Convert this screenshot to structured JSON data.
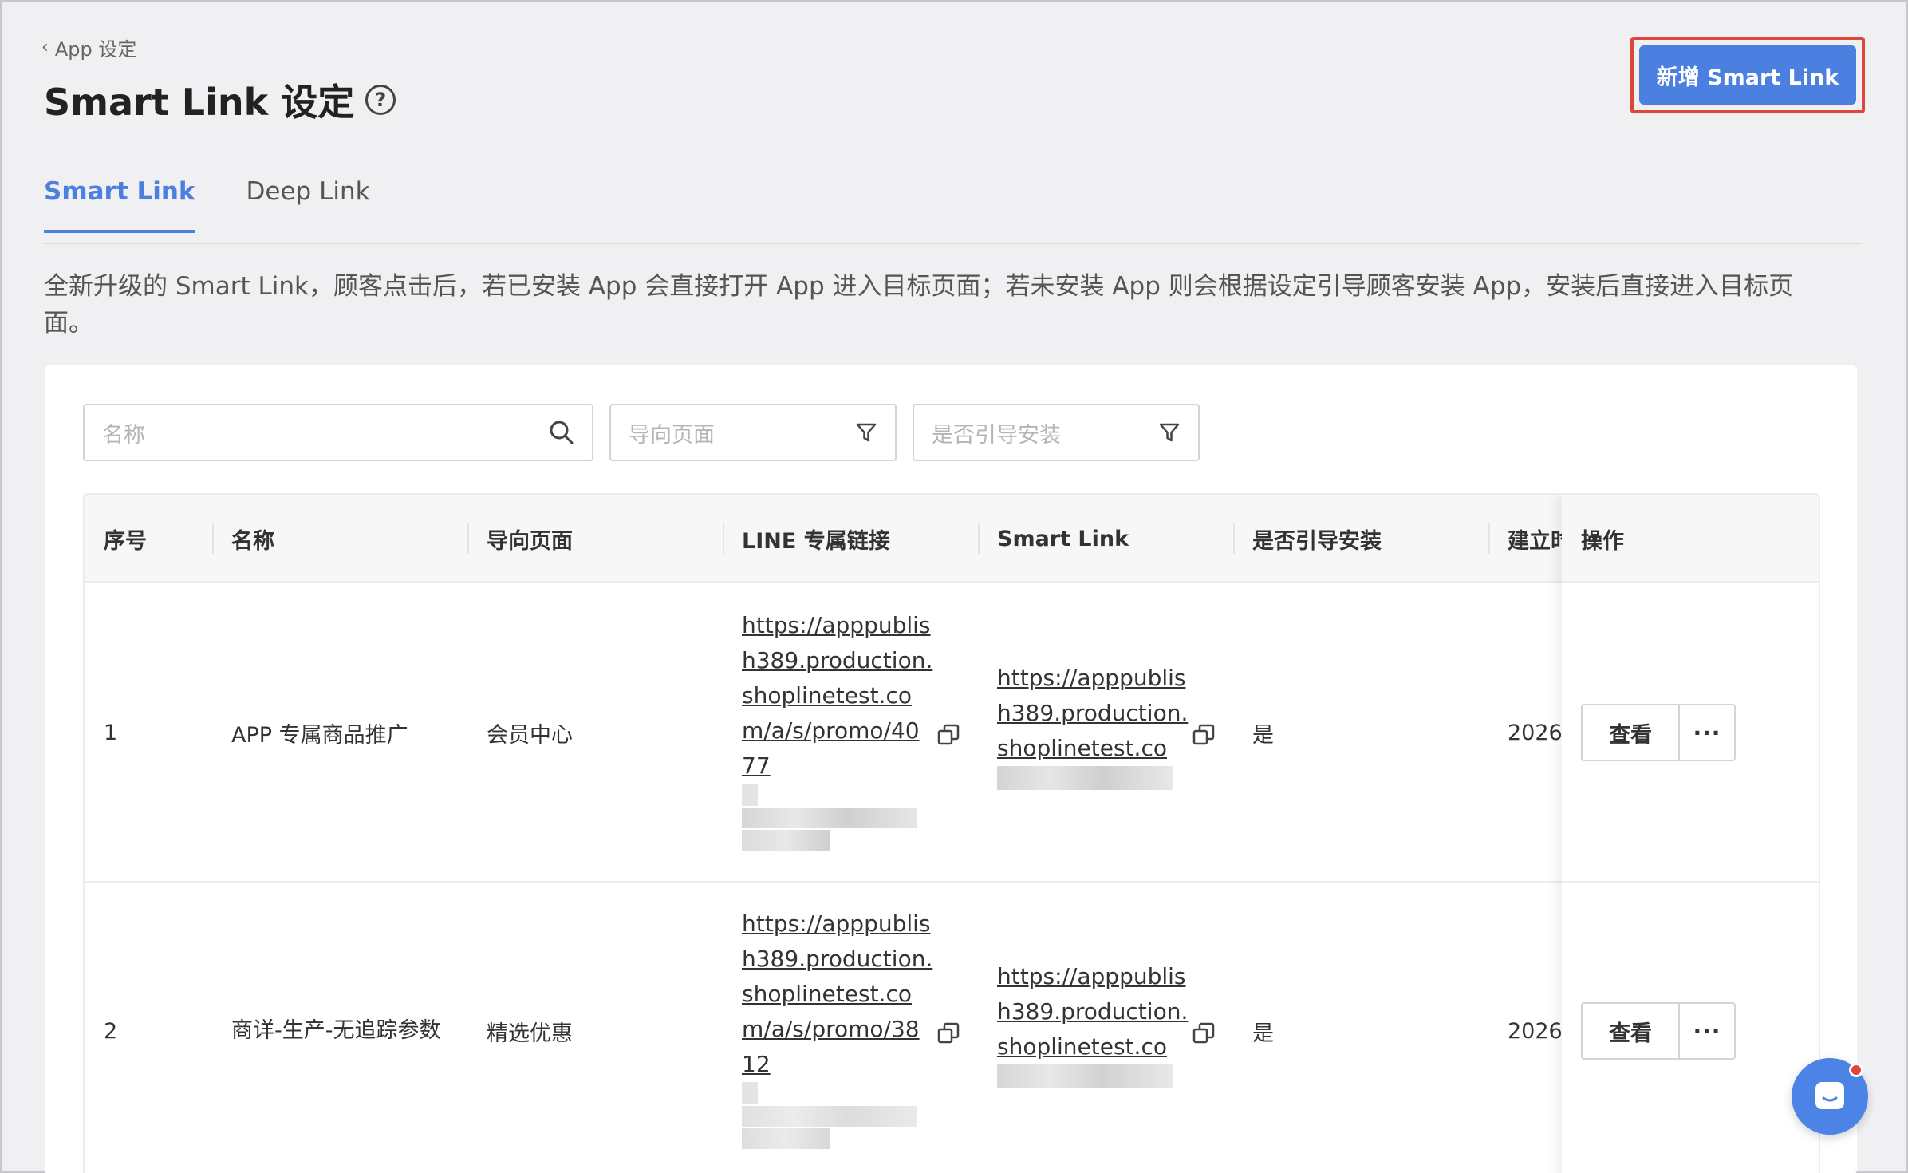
{
  "header": {
    "breadcrumb": "App 设定",
    "title": "Smart Link 设定",
    "primary_button": "新增 Smart Link"
  },
  "tabs": [
    {
      "label": "Smart Link",
      "active": true
    },
    {
      "label": "Deep Link",
      "active": false
    }
  ],
  "description": "全新升级的 Smart Link，顾客点击后，若已安装 App 会直接打开 App 进入目标页面；若未安装 App 则会根据设定引导顾客安装 App，安装后直接进入目标页面。",
  "filters": {
    "name_placeholder": "名称",
    "target_page_placeholder": "导向页面",
    "guide_install_placeholder": "是否引导安装"
  },
  "table": {
    "columns": [
      "序号",
      "名称",
      "导向页面",
      "LINE 专属链接",
      "Smart Link",
      "是否引导安装",
      "建立时间",
      "操作"
    ],
    "columns_visible": [
      "序号",
      "名称",
      "导向页面",
      "LINE 专属链接",
      "Smart Link",
      "是否引导安装",
      "建立！",
      "操作"
    ],
    "rows": [
      {
        "index": "1",
        "name": "APP 专属商品推广",
        "target_page": "会员中心",
        "line_link": "https://apppublish389.production.shoplinetest.com/a/s/promo/4077",
        "smart_link": "https://apppublish389.production.shoplinetest.com",
        "guide_install": "是",
        "created": "2026",
        "view_label": "查看",
        "more_label": "···"
      },
      {
        "index": "2",
        "name": "商详-生产-无追踪参数",
        "target_page": "精选优惠",
        "line_link": "https://apppublish389.production.shoplinetest.com/a/s/promo/3812",
        "smart_link": "https://apppublish389.production.shoplinetest.com",
        "guide_install": "是",
        "created": "2026",
        "view_label": "查看",
        "more_label": "···"
      }
    ]
  },
  "colors": {
    "primary": "#4b7fe0",
    "highlight": "#e0453b",
    "background": "#f0f0f2"
  },
  "icons": [
    "chevron-left-icon",
    "help-circle-icon",
    "search-icon",
    "filter-icon",
    "copy-icon",
    "chat-icon"
  ]
}
